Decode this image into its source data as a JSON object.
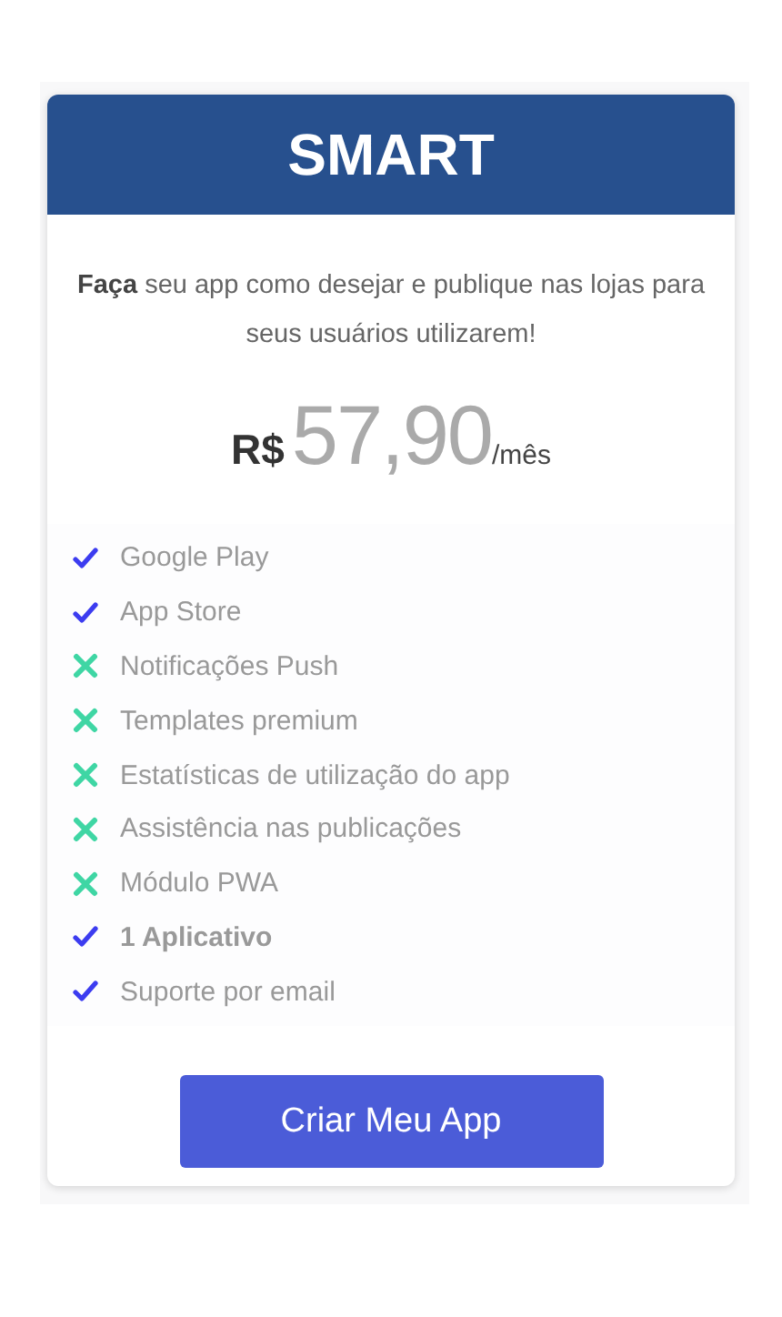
{
  "plan": {
    "title": "SMART",
    "description": "**Faça** seu app como desejar e publique nas lojas para seus usuários utilizarem!",
    "currency": "R$",
    "price": "57,90",
    "period": "/mês"
  },
  "features": [
    {
      "label": "Google Play",
      "included": true,
      "bold": false
    },
    {
      "label": "App Store",
      "included": true,
      "bold": false
    },
    {
      "label": "Notificações Push",
      "included": false,
      "bold": false
    },
    {
      "label": "Templates premium",
      "included": false,
      "bold": false
    },
    {
      "label": "Estatísticas de utilização do app",
      "included": false,
      "bold": false
    },
    {
      "label": "Assistência nas publicações",
      "included": false,
      "bold": false
    },
    {
      "label": "Módulo PWA",
      "included": false,
      "bold": false
    },
    {
      "label": "1 Aplicativo",
      "included": true,
      "bold": true
    },
    {
      "label": "Suporte por email",
      "included": true,
      "bold": false
    }
  ],
  "button": {
    "label": "Criar Meu App"
  }
}
